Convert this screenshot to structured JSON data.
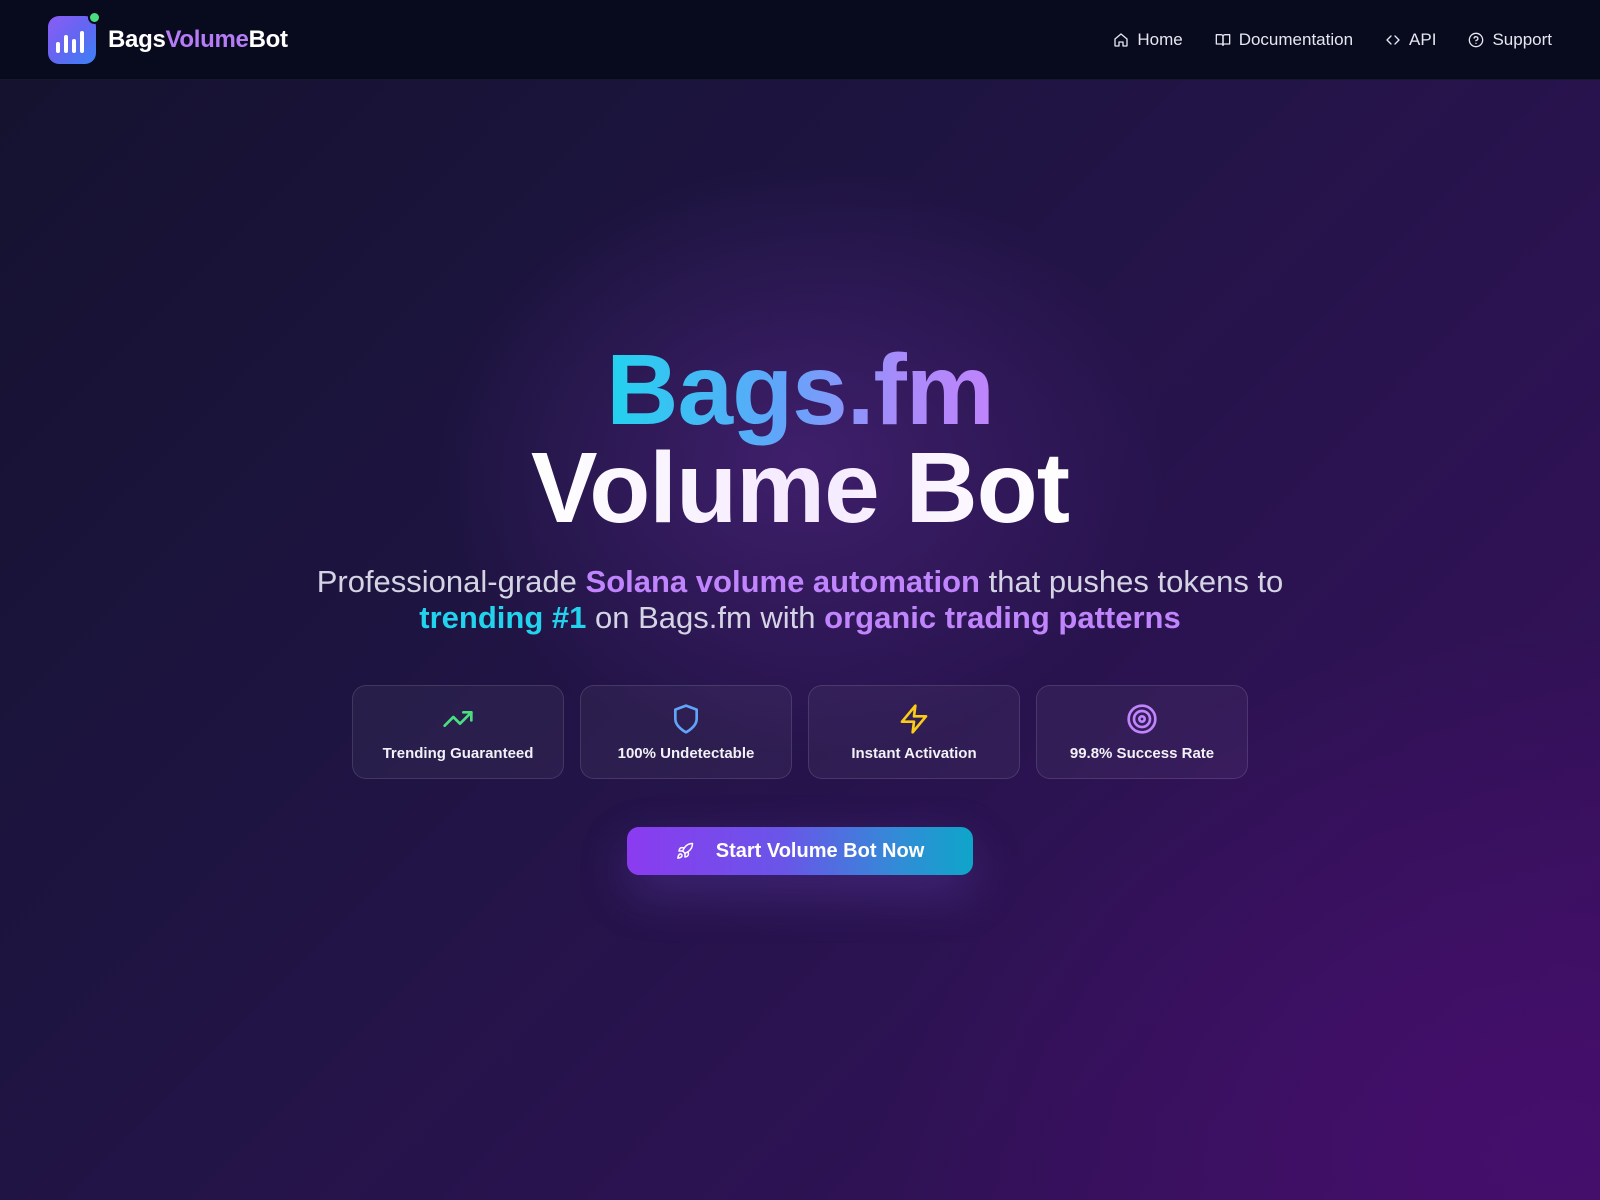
{
  "brand": {
    "part1": "Bags",
    "part2": "Volume",
    "part3": "Bot",
    "logo_icon": "bar-chart-icon",
    "status_color": "#4ade80"
  },
  "nav": {
    "items": [
      {
        "label": "Home",
        "icon": "home-icon"
      },
      {
        "label": "Documentation",
        "icon": "book-icon"
      },
      {
        "label": "API",
        "icon": "code-icon"
      },
      {
        "label": "Support",
        "icon": "help-circle-icon"
      }
    ]
  },
  "hero": {
    "title_line1": "Bags.fm",
    "title_line2": "Volume Bot",
    "subtitle": {
      "t1": "Professional-grade ",
      "h1": "Solana volume automation",
      "t2": " that pushes tokens to ",
      "h2": "trending #1",
      "t3": " on Bags.fm with ",
      "h3": "organic trading patterns"
    },
    "features": [
      {
        "label": "Trending Guaranteed",
        "icon": "trending-up-icon",
        "color": "#4ade80"
      },
      {
        "label": "100% Undetectable",
        "icon": "shield-icon",
        "color": "#60a5fa"
      },
      {
        "label": "Instant Activation",
        "icon": "lightning-icon",
        "color": "#facc15"
      },
      {
        "label": "99.8% Success Rate",
        "icon": "target-icon",
        "color": "#c084fc"
      }
    ],
    "cta": {
      "label": "Start Volume Bot Now",
      "icon": "rocket-icon"
    }
  },
  "colors": {
    "accent_purple": "#c084fc",
    "accent_cyan": "#22d3ee",
    "nav_bg": "#080a1e"
  }
}
